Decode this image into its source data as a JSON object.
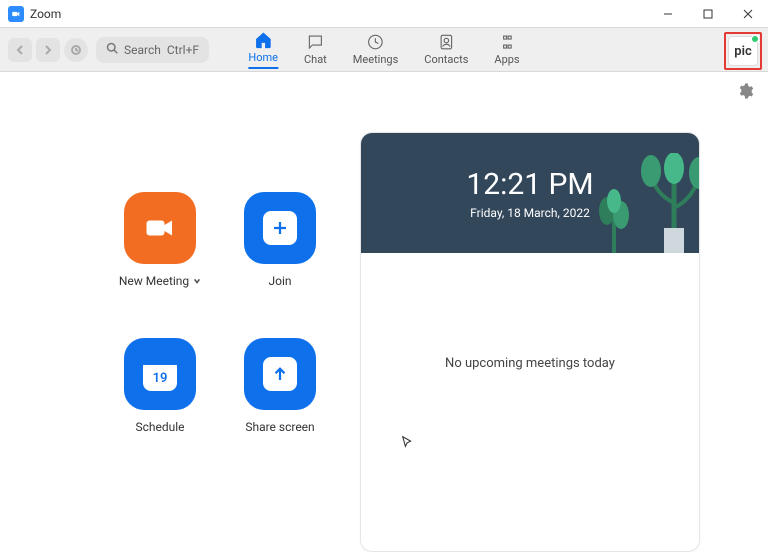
{
  "window": {
    "title": "Zoom"
  },
  "toolbar": {
    "search_label": "Search",
    "search_shortcut": "Ctrl+F",
    "tabs": [
      {
        "label": "Home"
      },
      {
        "label": "Chat"
      },
      {
        "label": "Meetings"
      },
      {
        "label": "Contacts"
      },
      {
        "label": "Apps"
      }
    ],
    "avatar_text": "pic"
  },
  "actions": {
    "new_meeting": "New Meeting",
    "join": "Join",
    "schedule": "Schedule",
    "schedule_day": "19",
    "share": "Share screen"
  },
  "panel": {
    "time": "12:21 PM",
    "date": "Friday, 18 March, 2022",
    "empty": "No upcoming meetings today"
  }
}
